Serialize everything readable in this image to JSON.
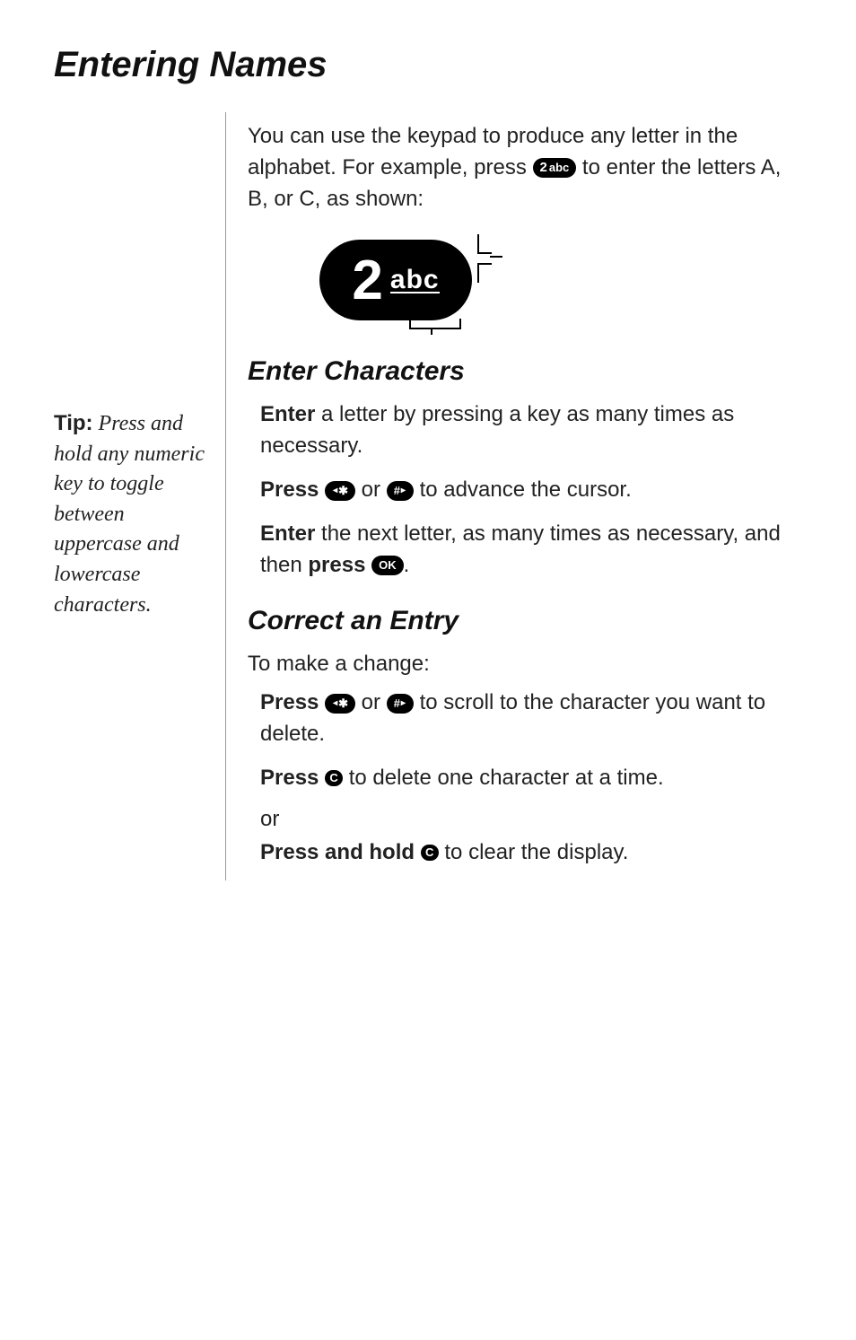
{
  "title": "Entering Names",
  "intro": {
    "line1_a": "You can use the keypad to produce any letter in the alphabet. For example, press ",
    "line1_b": " to enter the letters A, B, or C, as shown:"
  },
  "key2": {
    "digit": "2",
    "letters": "abc"
  },
  "bigkey": {
    "digit": "2",
    "letters": "abc"
  },
  "sidebar": {
    "head": "Tip:",
    "body": " Press and hold any numeric key to toggle between uppercase and lowercase characters."
  },
  "section1": {
    "heading": "Enter Characters",
    "step1_a": "Enter",
    "step1_b": " a letter by pressing a key as many times as necessary.",
    "step2_a": "Press ",
    "step2_b": " or ",
    "step2_c": " to advance the cursor.",
    "step3_a": "Enter",
    "step3_b": " the next letter, as many times as necessary, and then ",
    "step3_c": "press",
    "step3_d": " "
  },
  "section2": {
    "heading": "Correct an Entry",
    "intro": "To make a change:",
    "step1_a": "Press ",
    "step1_b": " or ",
    "step1_c": " to scroll to the character you want to delete.",
    "step2_a": "Press ",
    "step2_b": " to delete one character at a time.",
    "or": "or",
    "step3_a": "Press and hold ",
    "step3_b": " to clear the display."
  },
  "keys": {
    "star": {
      "left": "◂",
      "sym": "✱"
    },
    "hash": {
      "sym": "#",
      "right": "▸"
    },
    "ok": "OK",
    "c": "C"
  }
}
